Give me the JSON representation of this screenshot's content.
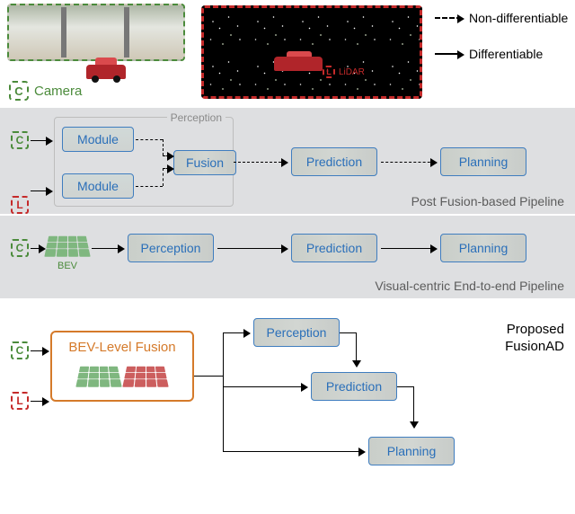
{
  "legend": {
    "camera_tag": "C",
    "camera_label": "Camera",
    "lidar_tag": "L",
    "lidar_label": "LiDAR",
    "nondiff_label": "Non-differentiable",
    "diff_label": "Differentiable"
  },
  "pipeline1": {
    "section_label": "Post Fusion-based Pipeline",
    "perception_label": "Perception",
    "module_label": "Module",
    "fusion_label": "Fusion",
    "prediction_label": "Prediction",
    "planning_label": "Planning"
  },
  "pipeline2": {
    "section_label": "Visual-centric End-to-end Pipeline",
    "bev_label": "BEV",
    "perception_label": "Perception",
    "prediction_label": "Prediction",
    "planning_label": "Planning"
  },
  "pipeline3": {
    "section_label": "Proposed FusionAD",
    "fusion_box_label": "BEV-Level Fusion",
    "perception_label": "Perception",
    "prediction_label": "Prediction",
    "planning_label": "Planning"
  },
  "chart_data": {
    "type": "diagram",
    "sensors": [
      {
        "id": "C",
        "name": "Camera",
        "color": "green"
      },
      {
        "id": "L",
        "name": "LiDAR",
        "color": "red"
      }
    ],
    "arrow_types": [
      {
        "style": "dashed",
        "meaning": "Non-differentiable"
      },
      {
        "style": "solid",
        "meaning": "Differentiable"
      }
    ],
    "pipelines": [
      {
        "name": "Post Fusion-based Pipeline",
        "stages": [
          {
            "id": "module_c",
            "label": "Module",
            "input_sensor": "C"
          },
          {
            "id": "module_l",
            "label": "Module",
            "input_sensor": "L"
          },
          {
            "id": "fusion",
            "label": "Fusion"
          },
          {
            "id": "prediction",
            "label": "Prediction"
          },
          {
            "id": "planning",
            "label": "Planning"
          }
        ],
        "perception_group": [
          "module_c",
          "module_l",
          "fusion"
        ],
        "edges": [
          {
            "from": "C-sensor",
            "to": "module_c",
            "diff": true
          },
          {
            "from": "L-sensor",
            "to": "module_l",
            "diff": true
          },
          {
            "from": "module_c",
            "to": "fusion",
            "diff": false
          },
          {
            "from": "module_l",
            "to": "fusion",
            "diff": false
          },
          {
            "from": "fusion",
            "to": "prediction",
            "diff": false
          },
          {
            "from": "prediction",
            "to": "planning",
            "diff": false
          }
        ]
      },
      {
        "name": "Visual-centric End-to-end Pipeline",
        "stages": [
          {
            "id": "bev",
            "label": "BEV"
          },
          {
            "id": "perception",
            "label": "Perception"
          },
          {
            "id": "prediction",
            "label": "Prediction"
          },
          {
            "id": "planning",
            "label": "Planning"
          }
        ],
        "edges": [
          {
            "from": "C-sensor",
            "to": "bev",
            "diff": true
          },
          {
            "from": "bev",
            "to": "perception",
            "diff": true
          },
          {
            "from": "perception",
            "to": "prediction",
            "diff": true
          },
          {
            "from": "prediction",
            "to": "planning",
            "diff": true
          }
        ]
      },
      {
        "name": "Proposed FusionAD",
        "stages": [
          {
            "id": "bev_fusion",
            "label": "BEV-Level Fusion"
          },
          {
            "id": "perception",
            "label": "Perception"
          },
          {
            "id": "prediction",
            "label": "Prediction"
          },
          {
            "id": "planning",
            "label": "Planning"
          }
        ],
        "edges": [
          {
            "from": "C-sensor",
            "to": "bev_fusion",
            "diff": true
          },
          {
            "from": "L-sensor",
            "to": "bev_fusion",
            "diff": true
          },
          {
            "from": "bev_fusion",
            "to": "perception",
            "diff": true
          },
          {
            "from": "bev_fusion",
            "to": "prediction",
            "diff": true
          },
          {
            "from": "bev_fusion",
            "to": "planning",
            "diff": true
          },
          {
            "from": "perception",
            "to": "prediction",
            "diff": true
          },
          {
            "from": "prediction",
            "to": "planning",
            "diff": true
          }
        ]
      }
    ]
  }
}
